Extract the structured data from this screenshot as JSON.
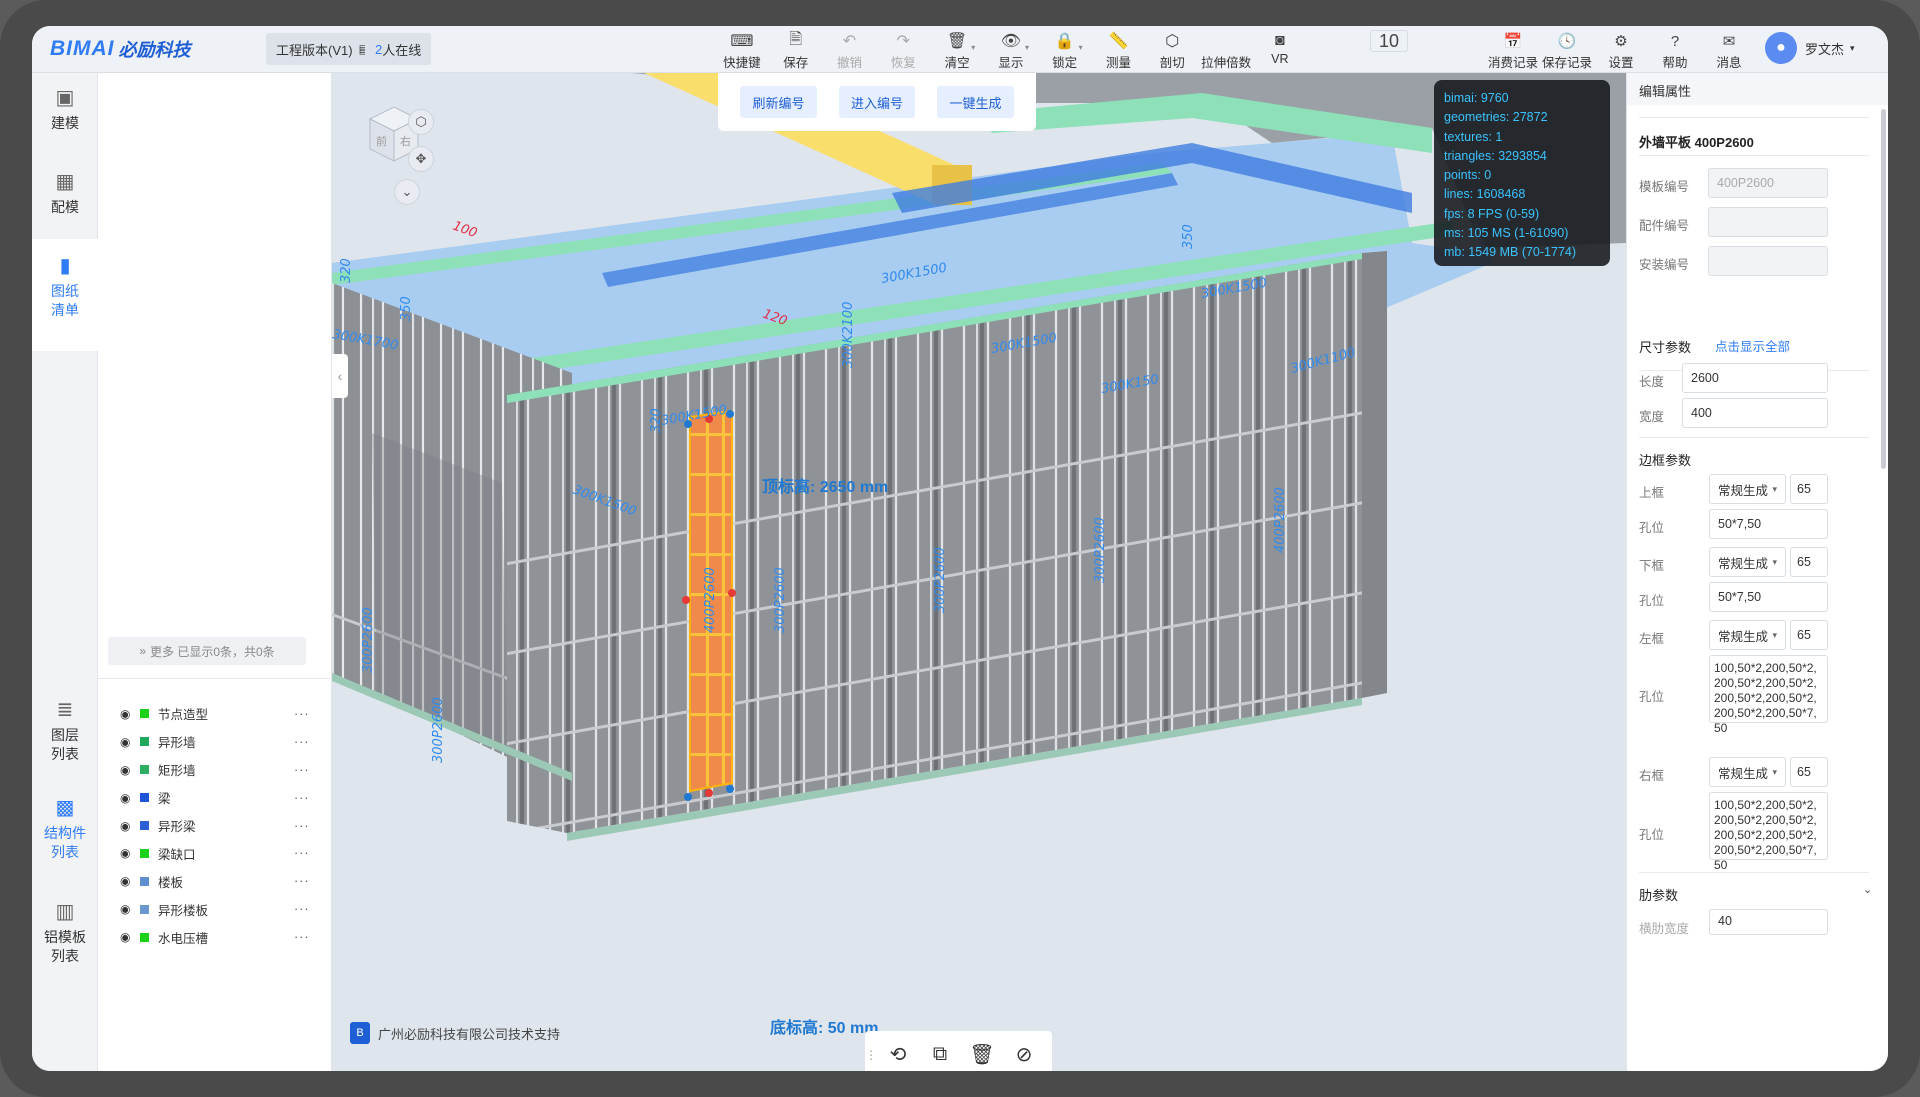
{
  "header": {
    "logo_latin": "BIMAI",
    "logo_cn": "必励科技",
    "version_label": "工程版本(V1)",
    "online_count": "2",
    "online_label": "人在线",
    "tools": [
      {
        "icon": "keyboard-icon",
        "label": "快捷键"
      },
      {
        "icon": "save-icon",
        "label": "保存"
      },
      {
        "icon": "undo-icon",
        "label": "撤销",
        "disabled": true
      },
      {
        "icon": "redo-icon",
        "label": "恢复",
        "disabled": true
      },
      {
        "icon": "trash-icon",
        "label": "清空"
      },
      {
        "icon": "eye-icon",
        "label": "显示"
      },
      {
        "icon": "lock-icon",
        "label": "锁定"
      },
      {
        "icon": "ruler-icon",
        "label": "测量"
      },
      {
        "icon": "section-cube-icon",
        "label": "剖切"
      },
      {
        "icon": "stretch-multiplier",
        "label": "拉伸倍数",
        "value": "10"
      },
      {
        "icon": "vr-icon",
        "label": "VR"
      }
    ],
    "right_tools": [
      {
        "icon": "consumption-record-icon",
        "label": "消费记录"
      },
      {
        "icon": "save-record-icon",
        "label": "保存记录"
      },
      {
        "icon": "gear-icon",
        "label": "设置"
      },
      {
        "icon": "help-icon",
        "label": "帮助"
      },
      {
        "icon": "message-icon",
        "label": "消息"
      }
    ],
    "user_name": "罗文杰"
  },
  "leftnav": {
    "items": [
      {
        "label": "建模"
      },
      {
        "label": "配模"
      },
      {
        "label": "图纸\n清单"
      },
      {
        "label": "图层\n列表"
      },
      {
        "label": "结构件\n列表"
      },
      {
        "label": "铝模板\n列表"
      }
    ]
  },
  "leftpanel": {
    "more_label": "更多 已显示0条，共0条",
    "layers": [
      {
        "label": "节点造型",
        "color": "#19d219"
      },
      {
        "label": "异形墙",
        "color": "#20a85a"
      },
      {
        "label": "矩形墙",
        "color": "#2dae63"
      },
      {
        "label": "梁",
        "color": "#2155d8"
      },
      {
        "label": "异形梁",
        "color": "#2d5fd6"
      },
      {
        "label": "梁缺口",
        "color": "#19d219"
      },
      {
        "label": "楼板",
        "color": "#5f8fd0"
      },
      {
        "label": "异形楼板",
        "color": "#6b97cf"
      },
      {
        "label": "水电压槽",
        "color": "#19d219"
      }
    ],
    "footer": "广州必励科技有限公司技术支持"
  },
  "viewport": {
    "buttons": [
      "刷新编号",
      "进入编号",
      "一键生成"
    ],
    "stats": [
      "bimai:  9760",
      "geometries:  27872",
      "textures:  1",
      "triangles:  3293854",
      "points:  0",
      "lines:  1608468",
      "fps:  8 FPS (0-59)",
      "ms:  105 MS (1-61090)",
      "mb:  1549 MB (70-1774)"
    ],
    "top_elevation": "顶标高:  2650 mm",
    "bottom_elevation": "底标高:  50 mm",
    "cube_faces": [
      "前",
      "右"
    ],
    "panel_labels": [
      "300K1500",
      "300K1500",
      "300K1500",
      "300K1500",
      "400P2600",
      "300P2600",
      "300P2600",
      "300P2600",
      "400P2600",
      "300P2600",
      "300P2600",
      "300K1500",
      "300K1700",
      "350",
      "320",
      "350",
      "320",
      "100",
      "120",
      "300K150",
      "300K1100",
      "300K2100"
    ]
  },
  "rightpanel": {
    "header": "编辑属性",
    "title": "外墙平板 400P2600",
    "fields": [
      {
        "label": "模板编号",
        "value": "400P2600"
      },
      {
        "label": "配件编号",
        "value": ""
      },
      {
        "label": "安装编号",
        "value": ""
      }
    ],
    "show_all": "点击显示全部",
    "size_section": "尺寸参数",
    "length_label": "长度",
    "length_value": "2600",
    "width_label": "宽度",
    "width_value": "400",
    "frame_section": "边框参数",
    "frames": [
      {
        "label": "上框",
        "mode": "常规生成",
        "value": "65",
        "holes_label": "孔位",
        "holes": "50*7,50"
      },
      {
        "label": "下框",
        "mode": "常规生成",
        "value": "65",
        "holes_label": "孔位",
        "holes": "50*7,50"
      },
      {
        "label": "左框",
        "mode": "常规生成",
        "value": "65",
        "holes_label": "孔位",
        "holes": "100,50*2,200,50*2,200,50*2,200,50*2,200,50*2,200,50*2,200,50*2,200,50*7,50"
      },
      {
        "label": "右框",
        "mode": "常规生成",
        "value": "65",
        "holes_label": "孔位",
        "holes": "100,50*2,200,50*2,200,50*2,200,50*2,200,50*2,200,50*2,200,50*2,200,50*7,50"
      }
    ],
    "rib_section": "肋参数",
    "rib_field_label": "横肋宽度",
    "rib_field_value": "40"
  },
  "colors": {
    "accent": "#2f7cf6",
    "sky_slab": "#a9cdf0",
    "wall_panel": "#8d9196",
    "highlight": "#f5a030",
    "beam_green": "#8de0b8",
    "beam_blue": "#3f7de0",
    "yellow_beam": "#f9de6c"
  }
}
